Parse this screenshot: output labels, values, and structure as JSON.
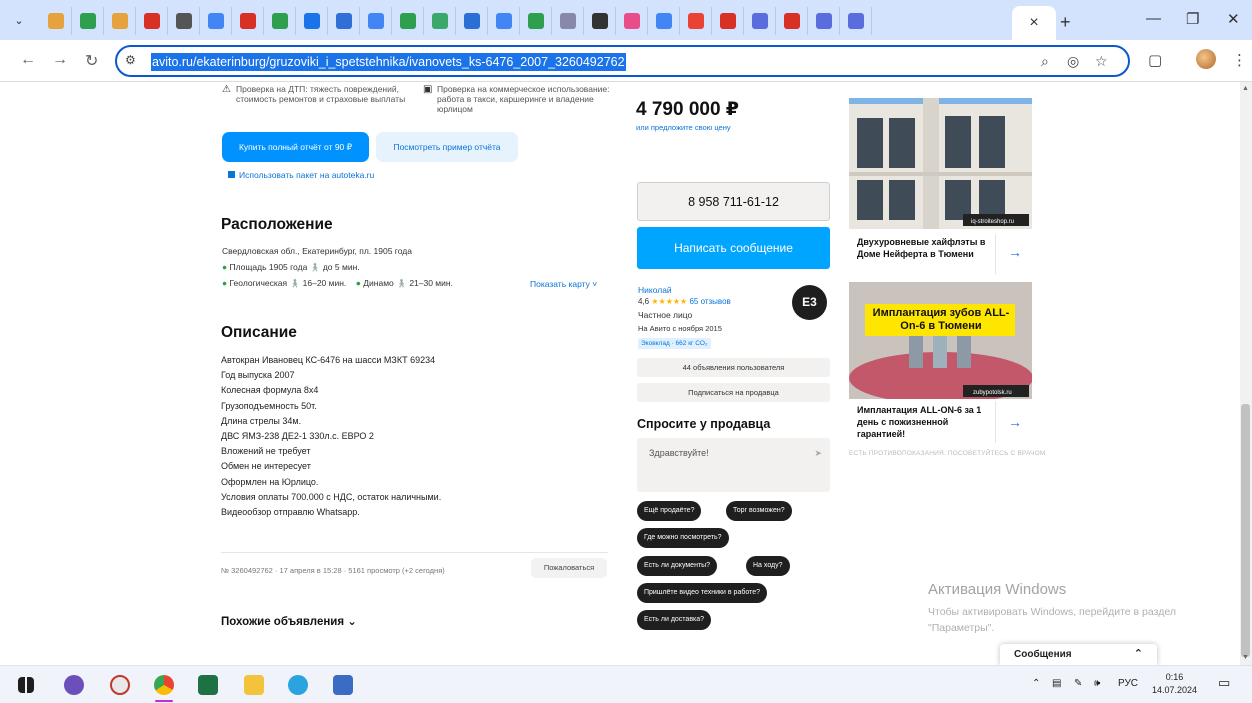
{
  "browser": {
    "tab_menu_icon": "chevron-down-icon",
    "tab_favicons": [
      "#e6a23c",
      "#2e9e4f",
      "#e6a23c",
      "#d93025",
      "#555555",
      "#4285f4",
      "#d93025",
      "#2e9e4f",
      "#1a73e8",
      "#2f6fd6",
      "#4285f4",
      "#2e9e4f",
      "#3aa86b",
      "#2b6fd6",
      "#4285f4",
      "#2e9e4f",
      "#88a",
      "#333333",
      "#e84d8a",
      "#4285f4",
      "#ea4335",
      "#d93025",
      "#5b6cde",
      "#d93025",
      "#5b6cde",
      "#5b6cde"
    ],
    "active_tab_close": "×",
    "new_tab": "+",
    "win_min": "—",
    "win_restore": "❐",
    "win_close": "✕",
    "url": "avito.ru/ekaterinburg/gruzoviki_i_spetstehnika/ivanovets_ks-6476_2007_3260492762",
    "back": "←",
    "forward": "→",
    "reload": "↻"
  },
  "history": {
    "feature_1": "Проверка на ДТП: тяжесть повреждений, стоимость ремонтов и страховые выплаты",
    "feature_2": "Проверка на коммерческое использование: работа в такси, каршеринге и владение юрлицом",
    "buy_report": "Купить полный отчёт от 90 ₽",
    "sample_report": "Посмотреть пример отчёта",
    "autoteka": "Использовать пакет на autoteka.ru"
  },
  "location": {
    "title": "Расположение",
    "address": "Свердловская обл., Екатеринбург, пл. 1905 года",
    "metro_1": "Площадь 1905 года",
    "metro_1_time": "до 5 мин.",
    "metro_2": "Геологическая",
    "metro_2_time": "16–20 мин.",
    "metro_3": "Динамо",
    "metro_3_time": "21–30 мин.",
    "show_map": "Показать карту"
  },
  "description": {
    "title": "Описание",
    "lines": [
      "Автокран Ивановец КС-6476 на шасси МЗКТ 69234",
      "Год выпуска 2007",
      "Колесная формула 8х4",
      "Грузоподъемность 50т.",
      "Длина стрелы 34м.",
      "ДВС ЯМЗ-238 ДЕ2-1 330л.с. ЕВРО 2",
      "Вложений не требует",
      "Обмен не интересует",
      "Оформлен на Юрлицо.",
      "Условия оплаты 700.000 с НДС, остаток наличными.",
      "Видеообзор отправлю Whatsapp."
    ]
  },
  "ad_info": "№ 3260492762 · 17 апреля в 15:28 · 5161 просмотр (+2 сегодня)",
  "complain": "Пожаловаться",
  "similar": "Похожие объявления ⌄",
  "sidebar": {
    "price": "4 790 000 ₽",
    "offer_price": "или предложите свою цену",
    "phone": "8 958 711-61-12",
    "write_message": "Написать сообщение",
    "seller_name": "Николай",
    "seller_rating": "4,6",
    "seller_stars": "★★★★★",
    "seller_reviews": "65 отзывов",
    "seller_type": "Частное лицо",
    "seller_since": "На Авито с ноября 2015",
    "eco": "Эковклад · 662 кг CO₂",
    "seller_logo": "Е3",
    "seller_ads": "44 объявления пользователя",
    "subscribe": "Подписаться на продавца",
    "ask_title": "Спросите у продавца",
    "ask_placeholder": "Здравствуйте!",
    "ask_send": "➤",
    "chips": [
      "Ещё продаёте?",
      "Торг возможен?",
      "Где можно посмотреть?",
      "Есть ли документы?",
      "На ходу?",
      "Пришлёте видео техники в работе?",
      "Есть ли доставка?"
    ]
  },
  "ads": {
    "ad1_text": "Двухуровневые хайфлэты в Доме Нейферта в Тюмени",
    "ad1_badge": "iq-stroiteshop.ru",
    "ad2_banner": "Имплантация зубов ALL-On-6 в Тюмени",
    "ad2_text": "Имплантация ALL-ON-6 за 1 день с пожизненной гарантией!",
    "ad2_badge": "zubypotolsk.ru",
    "arrow": "→",
    "footer": "ЕСТЬ ПРОТИВОПОКАЗАНИЯ. ПОСОВЕТУЙТЕСЬ С ВРАЧОМ"
  },
  "windows_activation": {
    "title": "Активация Windows",
    "subtitle": "Чтобы активировать Windows, перейдите в раздел \"Параметры\"."
  },
  "chat": {
    "label": "Сообщения",
    "toggle": "⌃"
  },
  "taskbar": {
    "lang": "РУС",
    "time": "0:16",
    "date": "14.07.2024"
  }
}
